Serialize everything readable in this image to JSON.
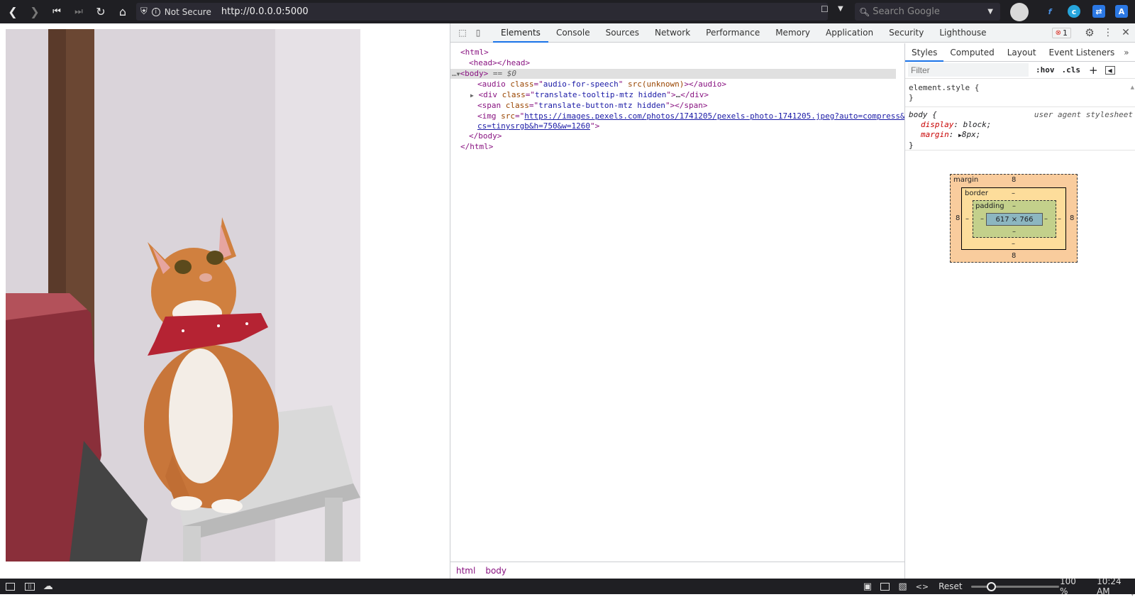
{
  "browser": {
    "security_label": "Not Secure",
    "url": "http://0.0.0.0:5000",
    "search_placeholder": "Search Google"
  },
  "devtools": {
    "tabs": [
      "Elements",
      "Console",
      "Sources",
      "Network",
      "Performance",
      "Memory",
      "Application",
      "Security",
      "Lighthouse"
    ],
    "error_count": "1",
    "dom": {
      "html_open": "<html>",
      "head": "<head></head>",
      "body_open": "<body>",
      "body_marker": "== $0",
      "audio_class": "audio-for-speech",
      "audio_src": "src(unknown)",
      "div_class": "translate-tooltip-mtz hidden",
      "span_class": "translate-button-mtz hidden",
      "img_src_line1": "https://images.pexels.com/photos/1741205/pexels-photo-1741205.jpeg?auto=compress&",
      "img_src_line2": "cs=tinysrgb&h=750&w=1260",
      "body_close": "</body>",
      "html_close": "</html>"
    },
    "breadcrumbs": [
      "html",
      "body"
    ],
    "styles": {
      "tabs": [
        "Styles",
        "Computed",
        "Layout",
        "Event Listeners"
      ],
      "filter_placeholder": "Filter",
      "hov": ":hov",
      "cls": ".cls",
      "element_style": "element.style {",
      "close_brace": "}",
      "body_selector": "body {",
      "origin": "user agent stylesheet",
      "prop1_name": "display",
      "prop1_value": "block;",
      "prop2_name": "margin",
      "prop2_value": "8px;"
    },
    "box_model": {
      "margin_label": "margin",
      "border_label": "border",
      "padding_label": "padding",
      "margin_value": "8",
      "dash": "–",
      "content_size": "617 × 766"
    }
  },
  "statusbar": {
    "reset_label": "Reset",
    "zoom_level": 0.2,
    "zoom_text": "100 %",
    "time": "10:24 AM"
  }
}
